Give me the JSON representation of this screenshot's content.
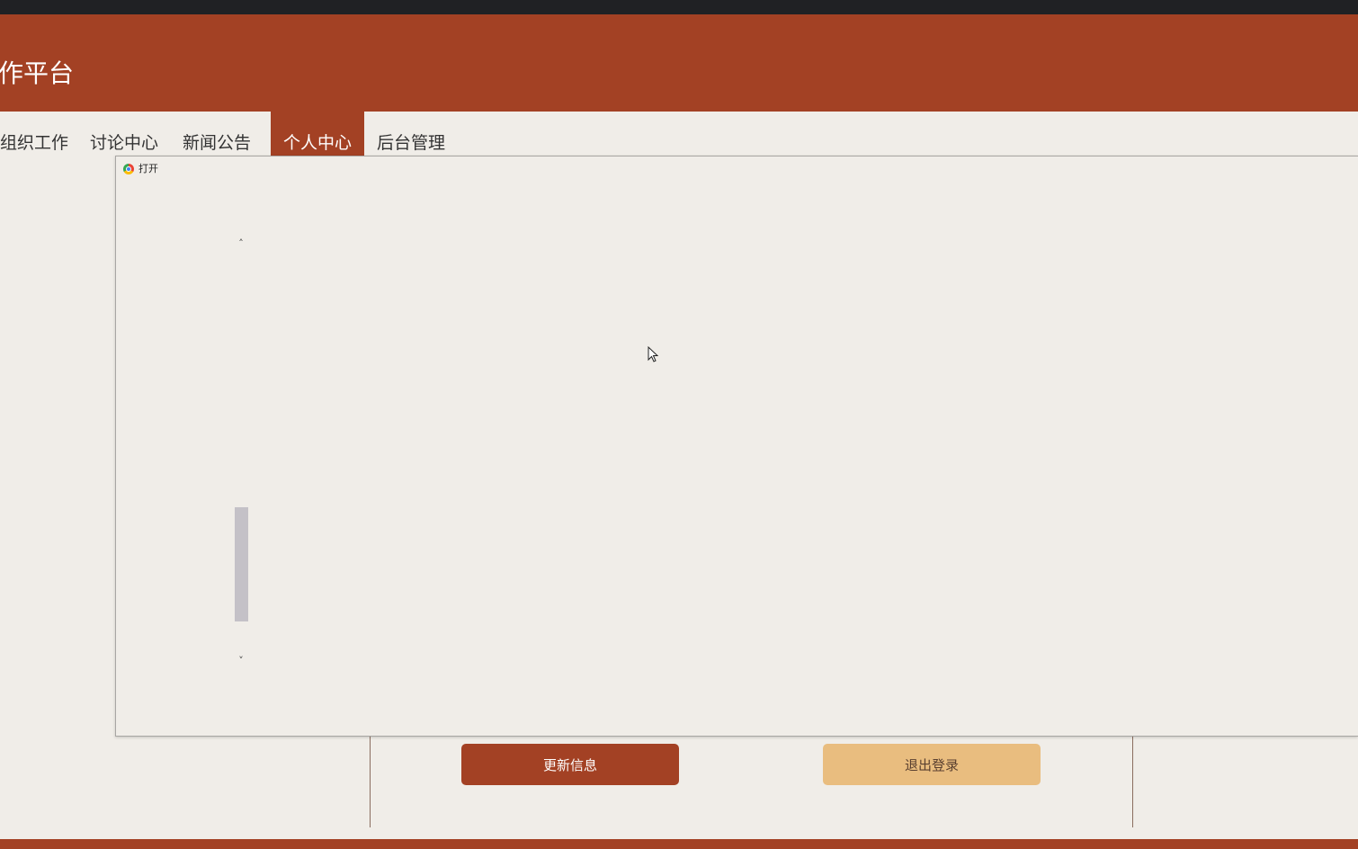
{
  "header": {
    "site_title": "作平台"
  },
  "nav": {
    "items": [
      {
        "label": "组织工作"
      },
      {
        "label": "讨论中心"
      },
      {
        "label": "新闻公告"
      },
      {
        "label": "个人中心",
        "active": true
      },
      {
        "label": "后台管理"
      }
    ]
  },
  "dialog": {
    "title": "打开",
    "scroll_up_glyph": "˄",
    "scroll_down_glyph": "˅"
  },
  "actions": {
    "update_label": "更新信息",
    "logout_label": "退出登录"
  },
  "colors": {
    "brand": "#a34124",
    "secondary_button": "#e9bd7f",
    "background": "#f0ede8"
  }
}
